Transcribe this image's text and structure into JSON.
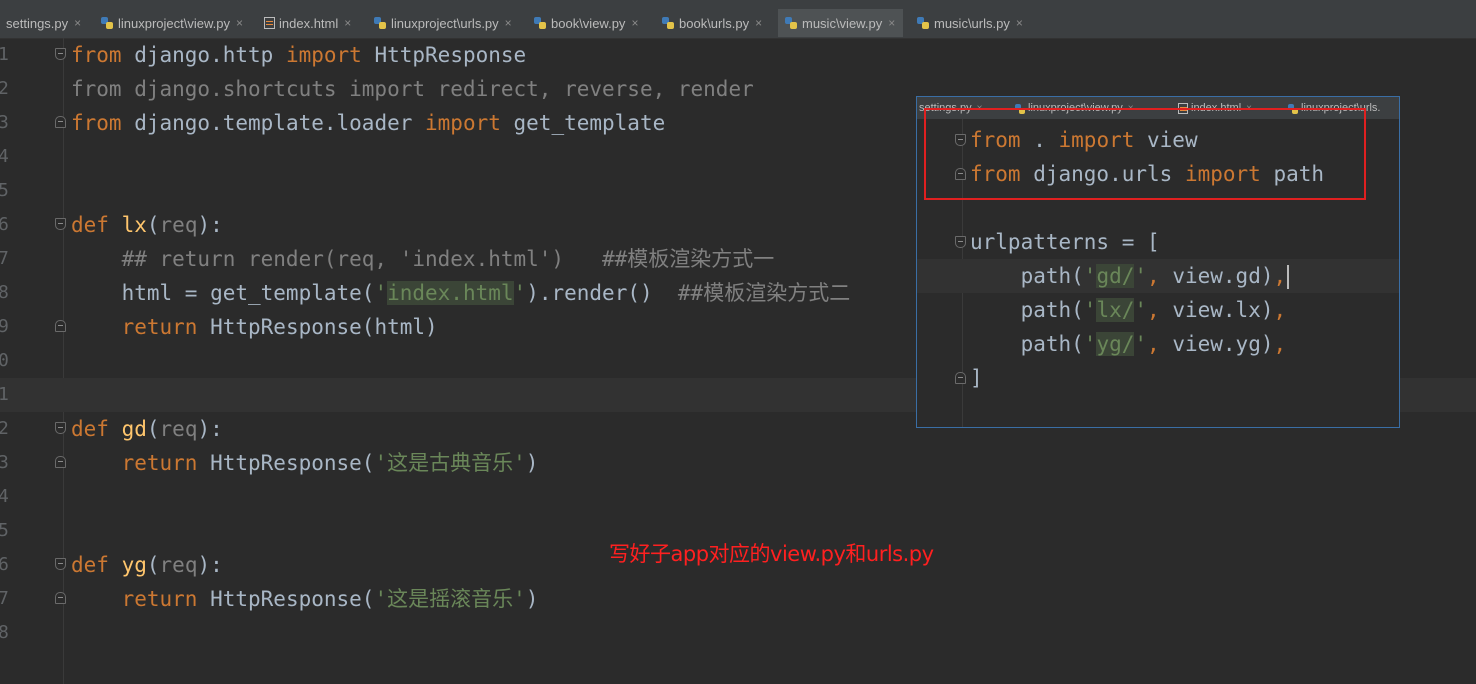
{
  "tabs": [
    {
      "label": "settings.py",
      "icon": "python-file-icon",
      "active": false
    },
    {
      "label": "linuxproject\\view.py",
      "icon": "python-file-icon",
      "active": false
    },
    {
      "label": "index.html",
      "icon": "html-file-icon",
      "active": false
    },
    {
      "label": "linuxproject\\urls.py",
      "icon": "python-file-icon",
      "active": false
    },
    {
      "label": "book\\view.py",
      "icon": "python-file-icon",
      "active": false
    },
    {
      "label": "book\\urls.py",
      "icon": "python-file-icon",
      "active": false
    },
    {
      "label": "music\\view.py",
      "icon": "python-file-icon",
      "active": true
    },
    {
      "label": "music\\urls.py",
      "icon": "python-file-icon",
      "active": false
    }
  ],
  "close_glyph": "×",
  "editor": {
    "line_numbers": [
      "1",
      "2",
      "3",
      "4",
      "5",
      "6",
      "7",
      "8",
      "9",
      "0",
      "1",
      "2",
      "3",
      "4",
      "5",
      "6",
      "7",
      "8"
    ],
    "code": {
      "l1_kw1": "from",
      "l1_mod": " django.http ",
      "l1_kw2": "import",
      "l1_name": " HttpResponse",
      "l2": "from django.shortcuts import redirect, reverse, render",
      "l3_kw1": "from",
      "l3_mod": " django.template.loader ",
      "l3_kw2": "import",
      "l3_name": " get_template",
      "l6_kw": "def",
      "l6_fn": " lx",
      "l6_open": "(",
      "l6_param": "req",
      "l6_close": "):",
      "l7": "    ## return render(req, 'index.html')   ##模板渲染方式一",
      "l8_a": "    html = get_template(",
      "l8_q1": "'",
      "l8_str": "index.html",
      "l8_q2": "'",
      "l8_b": ").render()  ",
      "l8_cmt": "##模板渲染方式二",
      "l9_kw": "    return",
      "l9_rest": " HttpResponse(html)",
      "l12_kw": "def",
      "l12_fn": " gd",
      "l12_open": "(",
      "l12_param": "req",
      "l12_close": "):",
      "l13_kw": "    return",
      "l13_a": " HttpResponse(",
      "l13_str": "'这是古典音乐'",
      "l13_b": ")",
      "l16_kw": "def",
      "l16_fn": " yg",
      "l16_open": "(",
      "l16_param": "req",
      "l16_close": "):",
      "l17_kw": "    return",
      "l17_a": " HttpResponse(",
      "l17_str": "'这是摇滚音乐'",
      "l17_b": ")"
    }
  },
  "overlay": {
    "tabs": [
      "settings.py",
      "linuxproject\\view.py",
      "index.html",
      "linuxproject\\urls."
    ],
    "code": {
      "o1_kw1": "from",
      "o1_mid": " . ",
      "o1_kw2": "import",
      "o1_name": " view",
      "o2_kw1": "from",
      "o2_mid": " django.urls ",
      "o2_kw2": "import",
      "o2_name": " path",
      "o4": "urlpatterns = [",
      "o5_a": "    path(",
      "o5_q1": "'",
      "o5_s": "gd/",
      "o5_q2": "'",
      "o5_c": ",",
      "o5_b": " view.gd)",
      "o5_c2": ",",
      "o6_a": "    path(",
      "o6_q1": "'",
      "o6_s": "lx/",
      "o6_q2": "'",
      "o6_c": ",",
      "o6_b": " view.lx)",
      "o6_c2": ",",
      "o7_a": "    path(",
      "o7_q1": "'",
      "o7_s": "yg/",
      "o7_q2": "'",
      "o7_c": ",",
      "o7_b": " view.yg)",
      "o7_c2": ",",
      "o8": "]"
    }
  },
  "annotation": "写好子app对应的view.py和urls.py",
  "colors": {
    "background": "#2b2b2b",
    "keyword": "#cc7832",
    "function": "#ffc66d",
    "string": "#6a8759",
    "comment": "#808080",
    "annotation": "#ff2020",
    "highlight_box": "#e02020"
  }
}
